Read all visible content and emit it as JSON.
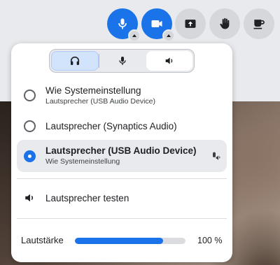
{
  "toolbar": {
    "controls": [
      "microphone-icon",
      "camera-icon",
      "present-screen-icon",
      "raise-hand-icon",
      "break-coffee-icon"
    ],
    "accent_color": "#1a73e8"
  },
  "audio_panel": {
    "tabs": [
      {
        "icon": "headphones-icon",
        "selected": true
      },
      {
        "icon": "microphone-icon",
        "selected": false
      },
      {
        "icon": "speaker-icon",
        "selected": false
      }
    ],
    "options": [
      {
        "label": "Wie Systemeinstellung",
        "sublabel": "Lautsprecher (USB Audio Device)",
        "selected": false
      },
      {
        "label": "Lautsprecher (Synaptics Audio)",
        "sublabel": "",
        "selected": false
      },
      {
        "label": "Lautsprecher (USB Audio Device)",
        "sublabel": "Wie Systemeinstellung",
        "selected": true
      }
    ],
    "test_label": "Lautsprecher testen",
    "volume": {
      "label": "Lautstärke",
      "value_text": "100 %",
      "level_fraction": 0.8
    }
  }
}
